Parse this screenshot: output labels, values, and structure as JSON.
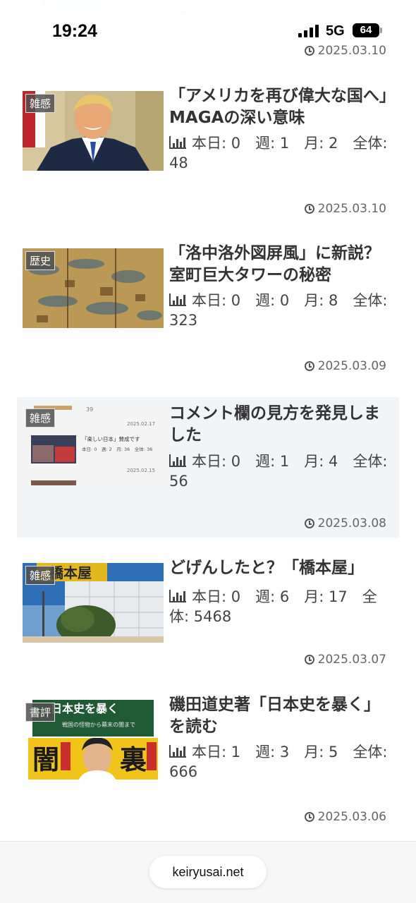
{
  "status_bar": {
    "time": "19:24",
    "network": "5G",
    "battery": "64"
  },
  "partial_post": {
    "count": "53",
    "date": "2025.03.10"
  },
  "posts": [
    {
      "category": "雑感",
      "title": "「アメリカを再び偉大な国へ」MAGAの深い意味",
      "stats": "本日: 0　週: 1　月: 2　全体: 48",
      "date": "2025.03.10"
    },
    {
      "category": "歴史",
      "title": "「洛中洛外図屏風」に新説？室町巨大タワーの秘密",
      "stats": "本日: 0　週: 0　月: 8　全体: 323",
      "date": "2025.03.09"
    },
    {
      "category": "雑感",
      "title": "コメント欄の見方を発見しました",
      "stats": "本日: 0　週: 1　月: 4　全体: 56",
      "date": "2025.03.08"
    },
    {
      "category": "雑感",
      "title": "どげんしたと？「橋本屋」",
      "stats": "本日: 0　週: 6　月: 17　全体: 5468",
      "date": "2025.03.07"
    },
    {
      "category": "書評",
      "title": "磯田道史著「日本史を暴く」を読む",
      "stats": "本日: 1　週: 3　月: 5　全体: 666",
      "date": "2025.03.06"
    }
  ],
  "thumb_text": {
    "screenshot_count": "39",
    "screenshot_date1": "2025.02.17",
    "screenshot_title": "「楽しい日本」賛成です",
    "screenshot_stats": "本日: 0　週: 2　月: 36　全体: 36",
    "screenshot_date2": "2025.02.15",
    "store_sign": "橋本屋",
    "book_top": "日本史を暴く",
    "book_sub": "戦国の怪物から幕末の闇まで",
    "book_left": "闇",
    "book_right": "裏"
  },
  "bottom_bar": {
    "url": "keiryusai.net"
  }
}
